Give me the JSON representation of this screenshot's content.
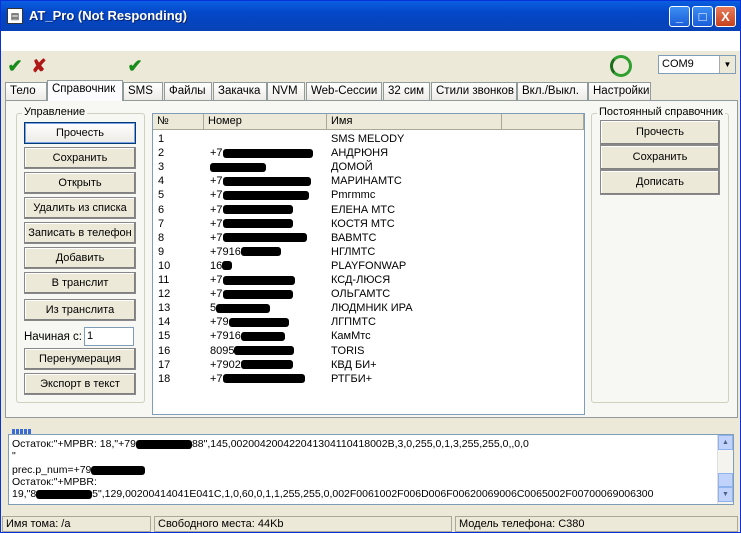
{
  "window": {
    "title": "AT_Pro (Not Responding)",
    "minimize_label": "_",
    "maximize_label": "□",
    "close_label": "X"
  },
  "toolbar": {
    "ok_icon": "✔",
    "cancel_icon": "✘",
    "apply_icon": "✔",
    "port_value": "COM9",
    "ok_color": "#1a8c1a",
    "cancel_color": "#b01818"
  },
  "tabs": [
    {
      "label": "Тело",
      "active": false
    },
    {
      "label": "Справочник",
      "active": true
    },
    {
      "label": "SMS",
      "active": false
    },
    {
      "label": "Файлы",
      "active": false
    },
    {
      "label": "Закачка",
      "active": false
    },
    {
      "label": "NVM",
      "active": false
    },
    {
      "label": "Web-Сессии",
      "active": false
    },
    {
      "label": "32 сим",
      "active": false
    },
    {
      "label": "Стили звонков",
      "active": false
    },
    {
      "label": "Вкл./Выкл.",
      "active": false
    },
    {
      "label": "Настройки",
      "active": false
    }
  ],
  "control_group": {
    "title": "Управление",
    "buttons": [
      "Прочесть",
      "Сохранить",
      "Открыть",
      "Удалить из списка",
      "Записать в телефон",
      "Добавить",
      "В транслит",
      "Из транслита"
    ],
    "start_label": "Начиная с:",
    "start_value": "1",
    "renumber": "Перенумерация",
    "export": "Экспорт в текст"
  },
  "grid": {
    "headers": [
      "№",
      "Номер",
      "Имя"
    ],
    "rows": [
      {
        "n": "1",
        "num": "",
        "name": "SMS MELODY"
      },
      {
        "n": "2",
        "num": "+7",
        "name": "АНДРЮНЯ"
      },
      {
        "n": "3",
        "num": "",
        "name": "ДОМОЙ"
      },
      {
        "n": "4",
        "num": "+7",
        "name": "МАРИНАМТС"
      },
      {
        "n": "5",
        "num": "+7",
        "name": "Pmгmmс"
      },
      {
        "n": "6",
        "num": "+7",
        "name": "ЕЛЕНА МТС"
      },
      {
        "n": "7",
        "num": "+7",
        "name": "КОСТЯ МТС"
      },
      {
        "n": "8",
        "num": "+7",
        "name": "ВАВМТС"
      },
      {
        "n": "9",
        "num": "+7916",
        "name": "НГЛМТС"
      },
      {
        "n": "10",
        "num": "16",
        "name": "PLAYFONWAP"
      },
      {
        "n": "11",
        "num": "+7",
        "name": "КСД-ЛЮСЯ"
      },
      {
        "n": "12",
        "num": "+7",
        "name": "ОЛЬГАМТС"
      },
      {
        "n": "13",
        "num": "5",
        "name": "ЛЮДМНИК ИРА"
      },
      {
        "n": "14",
        "num": "+79",
        "name": "ЛГПМТС"
      },
      {
        "n": "15",
        "num": "+7916",
        "name": "КамМтс"
      },
      {
        "n": "16",
        "num": "8095",
        "name": "TORIS"
      },
      {
        "n": "17",
        "num": "+7902",
        "name": "КВД БИ+"
      },
      {
        "n": "18",
        "num": "+7",
        "name": "РТГБИ+"
      }
    ]
  },
  "permanent_group": {
    "title": "Постоянный справочник",
    "buttons": [
      "Прочесть",
      "Сохранить",
      "Дописать"
    ]
  },
  "log": {
    "lines": [
      "Остаток:\"+MPBR: 18,\"+79",
      "88\",145,002004200422041304110418002B,3,0,255,0,1,3,255,255,0,,0,0",
      "\"",
      "prec.p_num=+79",
      "Остаток:\"+MPBR:",
      "19,\"8",
      "5\",129,00200414041E041C,1,0,60,0,1,1,255,255,0,002F0061002F006D006F00620069006C0065002F00700069006300"
    ]
  },
  "status": {
    "volume": "Имя тома: /a",
    "free": "Свободного места: 44Kb",
    "model": "Модель телефона: C380"
  }
}
